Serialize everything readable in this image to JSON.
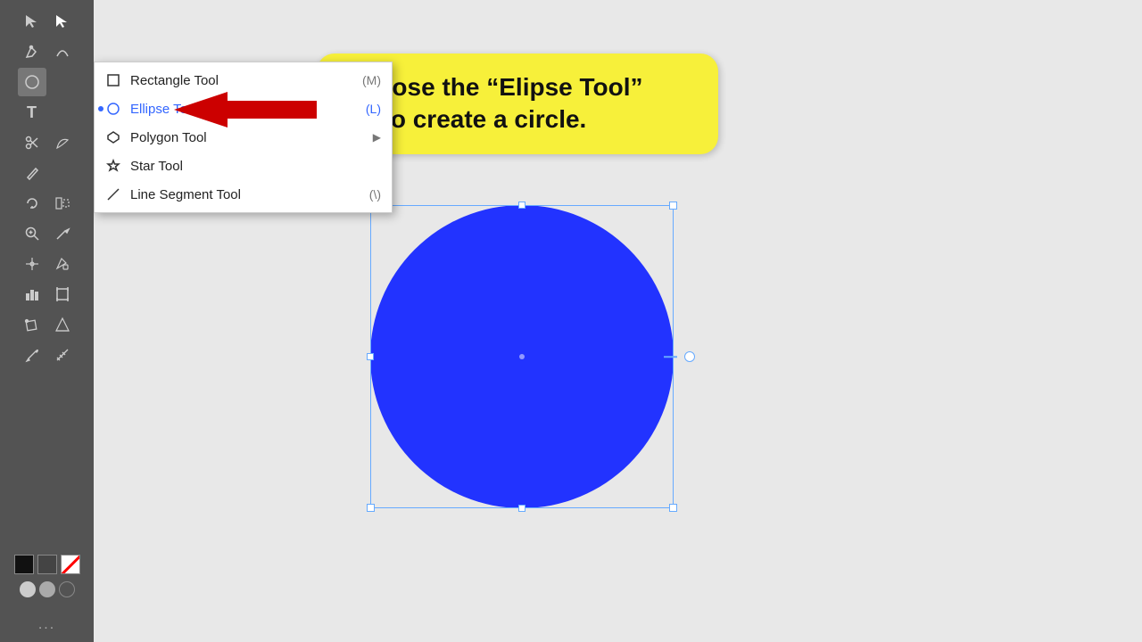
{
  "toolbar": {
    "tools": [
      {
        "name": "selection-tool",
        "icon": "arrow"
      },
      {
        "name": "direct-selection-tool",
        "icon": "white-arrow"
      },
      {
        "name": "pen-tool",
        "icon": "pen"
      },
      {
        "name": "curvature-tool",
        "icon": "curvature"
      },
      {
        "name": "ellipse-tool",
        "icon": "ellipse",
        "active": true
      },
      {
        "name": "type-tool",
        "icon": "T"
      },
      {
        "name": "scissors-tool",
        "icon": "scissors"
      },
      {
        "name": "warp-tool",
        "icon": "warp"
      },
      {
        "name": "pencil-tool",
        "icon": "pencil"
      },
      {
        "name": "blend-tool",
        "icon": "blend"
      },
      {
        "name": "mesh-tool",
        "icon": "mesh"
      },
      {
        "name": "column-chart-tool",
        "icon": "chart"
      },
      {
        "name": "zoom-tool",
        "icon": "zoom"
      },
      {
        "name": "magic-wand-tool",
        "icon": "wand"
      },
      {
        "name": "gradient-tool",
        "icon": "gradient"
      },
      {
        "name": "live-paint-tool",
        "icon": "paint"
      },
      {
        "name": "smooth-tool",
        "icon": "smooth"
      },
      {
        "name": "free-transform-tool",
        "icon": "transform"
      },
      {
        "name": "perspective-tool",
        "icon": "perspective"
      },
      {
        "name": "symbol-spray-tool",
        "icon": "symbol"
      },
      {
        "name": "eyedropper-tool",
        "icon": "eyedropper"
      },
      {
        "name": "measure-tool",
        "icon": "measure"
      }
    ],
    "more_dots": "..."
  },
  "dropdown": {
    "items": [
      {
        "label": "Rectangle Tool",
        "shortcut": "(M)",
        "icon": "rectangle",
        "selected": false
      },
      {
        "label": "Ellipse Tool",
        "shortcut": "(L)",
        "icon": "ellipse",
        "selected": true
      },
      {
        "label": "Polygon Tool",
        "shortcut": "",
        "icon": "polygon",
        "selected": false,
        "hasArrow": true
      },
      {
        "label": "Star Tool",
        "shortcut": "",
        "icon": "star",
        "selected": false
      },
      {
        "label": "Line Segment Tool",
        "shortcut": "(\\)",
        "icon": "line",
        "selected": false
      }
    ]
  },
  "callout": {
    "line1": "Choose the “Elipse Tool”",
    "line2": "(L) to create a circle."
  },
  "canvas": {
    "circle_color": "#2233ff",
    "selection_color": "#66aaff"
  }
}
